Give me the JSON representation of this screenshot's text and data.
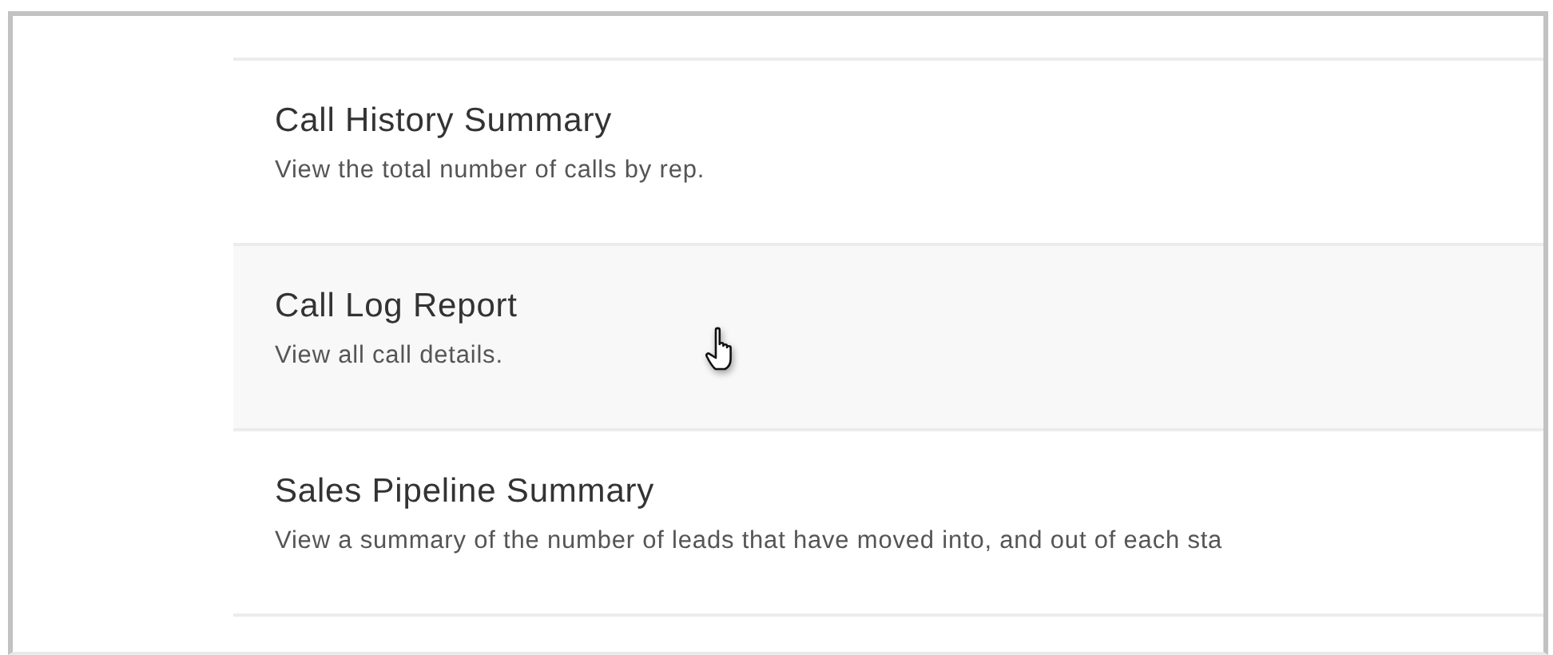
{
  "reports": [
    {
      "title": "Call History Summary",
      "description": "View the total number of calls by rep.",
      "hovered": false
    },
    {
      "title": "Call Log Report",
      "description": "View all call details.",
      "hovered": true
    },
    {
      "title": "Sales Pipeline Summary",
      "description": "View a summary of the number of leads that have moved into, and out of each sta",
      "hovered": false
    }
  ]
}
